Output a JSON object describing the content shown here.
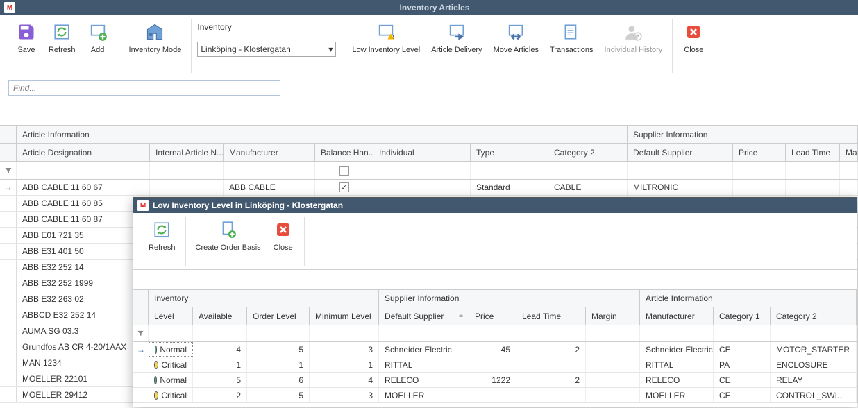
{
  "window": {
    "title": "Inventory Articles"
  },
  "ribbon": {
    "save": "Save",
    "refresh": "Refresh",
    "add": "Add",
    "inventory_mode": "Inventory Mode",
    "inventory_label": "Inventory",
    "inventory_selected": "Linköping - Klostergatan",
    "low_inventory": "Low Inventory Level",
    "article_delivery": "Article Delivery",
    "move_articles": "Move Articles",
    "transactions": "Transactions",
    "individual_history": "Individual History",
    "close": "Close"
  },
  "find": {
    "placeholder": "Find..."
  },
  "main_groups": {
    "article_info": "Article Information",
    "supplier_info": "Supplier Information"
  },
  "main_cols": {
    "article_designation": "Article Designation",
    "internal_article_n": "Internal Article N...",
    "manufacturer": "Manufacturer",
    "balance_han": "Balance Han...",
    "individual": "Individual",
    "type": "Type",
    "category2": "Category 2",
    "default_supplier": "Default Supplier",
    "price": "Price",
    "lead_time": "Lead Time",
    "margin": "Marg"
  },
  "main_rows": [
    {
      "article": "ABB CABLE 11 60 67",
      "man": "ABB CABLE",
      "bal": true,
      "type": "Standard",
      "cat": "CABLE",
      "def": "MILTRONIC"
    },
    {
      "article": "ABB CABLE 11 60 85"
    },
    {
      "article": "ABB CABLE 11 60 87"
    },
    {
      "article": "ABB E01 721 35"
    },
    {
      "article": "ABB E31 401 50"
    },
    {
      "article": "ABB E32 252 14"
    },
    {
      "article": "ABB E32 252 1999"
    },
    {
      "article": "ABB E32 263 02"
    },
    {
      "article": "ABBCD E32 252 14"
    },
    {
      "article": "AUMA SG 03.3"
    },
    {
      "article": "Grundfos AB CR 4-20/1AAX"
    },
    {
      "article": "MAN 1234"
    },
    {
      "article": "MOELLER 22101"
    },
    {
      "article": "MOELLER 29412"
    }
  ],
  "popup": {
    "title": "Low Inventory Level in Linköping - Klostergatan",
    "refresh": "Refresh",
    "create_order_basis": "Create Order Basis",
    "close": "Close",
    "groups": {
      "inventory": "Inventory",
      "supplier_info": "Supplier Information",
      "article_info": "Article Information"
    },
    "cols": {
      "level": "Level",
      "available": "Available",
      "order_level": "Order Level",
      "minimum_level": "Minimum Level",
      "default_supplier": "Default Supplier",
      "price": "Price",
      "lead_time": "Lead Time",
      "margin": "Margin",
      "manufacturer": "Manufacturer",
      "category1": "Category 1",
      "category2": "Category 2"
    },
    "rows": [
      {
        "level": "Normal",
        "available": 4,
        "order": 5,
        "min": 3,
        "supplier": "Schneider Electric",
        "price": 45,
        "lead": 2,
        "margin": "",
        "man": "Schneider Electric",
        "c1": "CE",
        "c2": "MOTOR_STARTER"
      },
      {
        "level": "Critical",
        "available": 1,
        "order": 1,
        "min": 1,
        "supplier": "RITTAL",
        "price": "",
        "lead": "",
        "margin": "",
        "man": "RITTAL",
        "c1": "PA",
        "c2": "ENCLOSURE"
      },
      {
        "level": "Normal",
        "available": 5,
        "order": 6,
        "min": 4,
        "supplier": "RELECO",
        "price": 1222,
        "lead": 2,
        "margin": "",
        "man": "RELECO",
        "c1": "CE",
        "c2": "RELAY"
      },
      {
        "level": "Critical",
        "available": 2,
        "order": 5,
        "min": 3,
        "supplier": "MOELLER",
        "price": "",
        "lead": "",
        "margin": "",
        "man": "MOELLER",
        "c1": "CE",
        "c2": "CONTROL_SWI..."
      }
    ]
  }
}
